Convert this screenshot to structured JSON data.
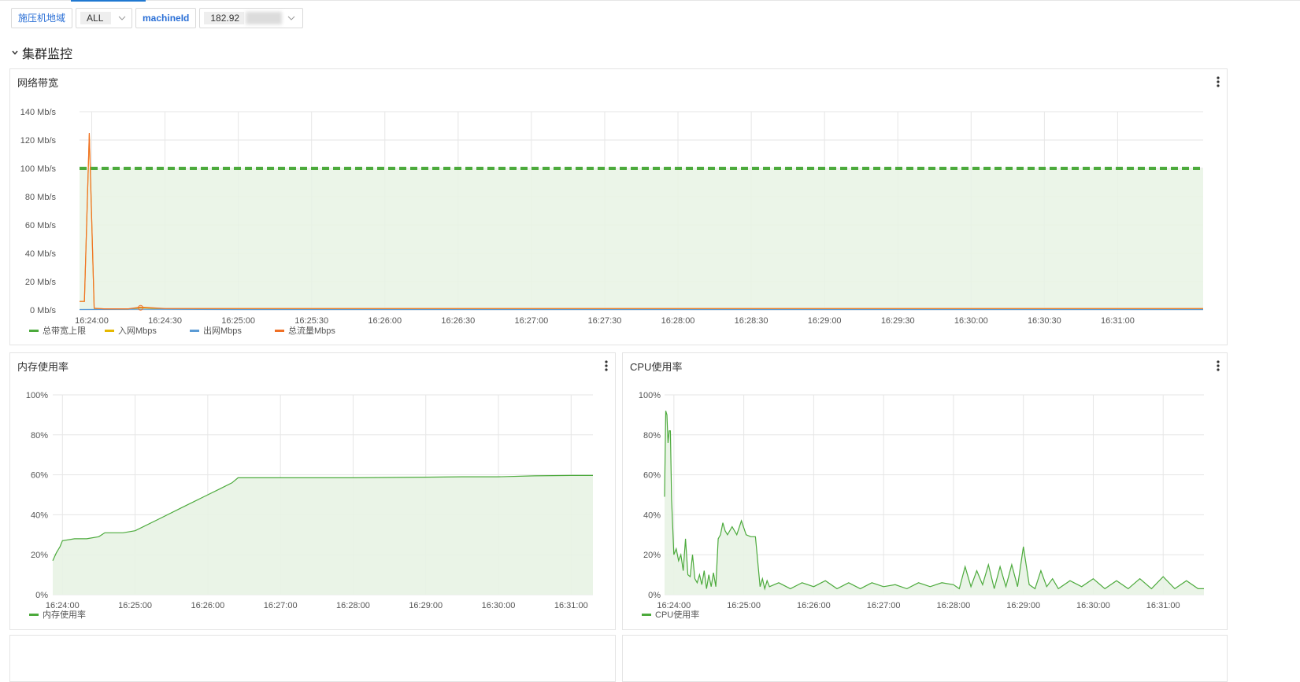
{
  "filters": {
    "region_label": "施压机地域",
    "region_value": "ALL",
    "machine_label": "machineId",
    "machine_value": "182.92"
  },
  "section": {
    "title": "集群监控"
  },
  "panels": {
    "bandwidth": {
      "title": "网络带宽"
    },
    "memory": {
      "title": "内存使用率"
    },
    "cpu": {
      "title": "CPU使用率"
    }
  },
  "colors": {
    "limit": "#4caa3c",
    "in": "#e6b800",
    "out": "#5b9bd5",
    "total": "#f07025",
    "series_green": "#4caa3c",
    "fill_green": "#e8f3e4"
  },
  "chart_data": [
    {
      "type": "line",
      "title": "网络带宽",
      "x_ticks": [
        "16:24:00",
        "16:24:30",
        "16:25:00",
        "16:25:30",
        "16:26:00",
        "16:26:30",
        "16:27:00",
        "16:27:30",
        "16:28:00",
        "16:28:30",
        "16:29:00",
        "16:29:30",
        "16:30:00",
        "16:30:30",
        "16:31:00"
      ],
      "y_ticks": [
        "0 Mb/s",
        "20 Mb/s",
        "40 Mb/s",
        "60 Mb/s",
        "80 Mb/s",
        "100 Mb/s",
        "120 Mb/s",
        "140 Mb/s"
      ],
      "ylim": [
        0,
        140
      ],
      "legend": "bottom-left",
      "grid": true,
      "series": [
        {
          "name": "总带宽上限",
          "style": "dashed-area",
          "x": [
            "16:23:55",
            "16:31:35"
          ],
          "values": [
            100,
            100
          ]
        },
        {
          "name": "入网Mbps",
          "x": [
            "16:23:55",
            "16:23:57",
            "16:23:59",
            "16:24:01",
            "16:24:05",
            "16:24:15",
            "16:24:20",
            "16:24:30",
            "16:25:00",
            "16:26:00",
            "16:27:00",
            "16:28:00",
            "16:29:00",
            "16:30:00",
            "16:31:00",
            "16:31:35"
          ],
          "values": [
            6,
            6,
            124,
            1,
            0.5,
            0.5,
            1.5,
            0.8,
            0.8,
            0.8,
            0.8,
            0.8,
            0.8,
            0.8,
            0.8,
            0.8
          ]
        },
        {
          "name": "出网Mbps",
          "x": [
            "16:23:55",
            "16:24:20",
            "16:25:00",
            "16:26:00",
            "16:27:00",
            "16:28:00",
            "16:29:00",
            "16:30:00",
            "16:31:00",
            "16:31:35"
          ],
          "values": [
            0.3,
            0.5,
            0.3,
            0.3,
            0.3,
            0.3,
            0.3,
            0.3,
            0.3,
            0.3
          ]
        },
        {
          "name": "总流量Mbps",
          "x": [
            "16:23:55",
            "16:23:57",
            "16:23:59",
            "16:24:01",
            "16:24:05",
            "16:24:15",
            "16:24:20",
            "16:24:30",
            "16:25:00",
            "16:26:00",
            "16:27:00",
            "16:28:00",
            "16:29:00",
            "16:30:00",
            "16:31:00",
            "16:31:35"
          ],
          "values": [
            6,
            6,
            125,
            1.2,
            0.8,
            0.8,
            2,
            1,
            1,
            1,
            1,
            1,
            1,
            1,
            1,
            1
          ]
        }
      ]
    },
    {
      "type": "area",
      "title": "内存使用率",
      "x_ticks": [
        "16:24:00",
        "16:25:00",
        "16:26:00",
        "16:27:00",
        "16:28:00",
        "16:29:00",
        "16:30:00",
        "16:31:00"
      ],
      "y_ticks": [
        "0%",
        "20%",
        "40%",
        "60%",
        "80%",
        "100%"
      ],
      "ylim": [
        0,
        100
      ],
      "legend": "bottom-left",
      "grid": true,
      "series": [
        {
          "name": "内存使用率",
          "x": [
            "16:23:52",
            "16:23:55",
            "16:23:58",
            "16:24:00",
            "16:24:10",
            "16:24:20",
            "16:24:30",
            "16:24:35",
            "16:24:50",
            "16:25:00",
            "16:25:20",
            "16:25:40",
            "16:26:00",
            "16:26:10",
            "16:26:20",
            "16:26:25",
            "16:27:00",
            "16:28:00",
            "16:29:00",
            "16:29:30",
            "16:30:00",
            "16:30:30",
            "16:31:00",
            "16:31:18"
          ],
          "values": [
            17,
            21,
            24,
            27,
            28,
            28,
            29,
            31,
            31,
            32,
            38,
            44,
            50,
            53,
            56,
            58.5,
            58.5,
            58.5,
            58.8,
            59,
            59,
            59.5,
            59.7,
            59.7
          ]
        }
      ]
    },
    {
      "type": "area",
      "title": "CPU使用率",
      "x_ticks": [
        "16:24:00",
        "16:25:00",
        "16:26:00",
        "16:27:00",
        "16:28:00",
        "16:29:00",
        "16:30:00",
        "16:31:00"
      ],
      "y_ticks": [
        "0%",
        "20%",
        "40%",
        "60%",
        "80%",
        "100%"
      ],
      "ylim": [
        0,
        100
      ],
      "legend": "bottom-left",
      "grid": true,
      "series": [
        {
          "name": "CPU使用率",
          "x": [
            "16:23:52",
            "16:23:53",
            "16:23:54",
            "16:23:55",
            "16:23:56",
            "16:23:57",
            "16:23:58",
            "16:24:00",
            "16:24:02",
            "16:24:04",
            "16:24:06",
            "16:24:08",
            "16:24:10",
            "16:24:12",
            "16:24:14",
            "16:24:16",
            "16:24:18",
            "16:24:20",
            "16:24:22",
            "16:24:24",
            "16:24:26",
            "16:24:28",
            "16:24:30",
            "16:24:32",
            "16:24:34",
            "16:24:36",
            "16:24:38",
            "16:24:40",
            "16:24:42",
            "16:24:44",
            "16:24:46",
            "16:24:50",
            "16:24:54",
            "16:24:58",
            "16:25:02",
            "16:25:06",
            "16:25:10",
            "16:25:14",
            "16:25:16",
            "16:25:18",
            "16:25:20",
            "16:25:22",
            "16:25:30",
            "16:25:40",
            "16:25:50",
            "16:26:00",
            "16:26:10",
            "16:26:20",
            "16:26:30",
            "16:26:40",
            "16:26:50",
            "16:27:00",
            "16:27:10",
            "16:27:20",
            "16:27:30",
            "16:27:40",
            "16:27:50",
            "16:28:00",
            "16:28:05",
            "16:28:10",
            "16:28:15",
            "16:28:20",
            "16:28:25",
            "16:28:30",
            "16:28:35",
            "16:28:40",
            "16:28:45",
            "16:28:50",
            "16:28:55",
            "16:29:00",
            "16:29:05",
            "16:29:10",
            "16:29:15",
            "16:29:20",
            "16:29:25",
            "16:29:30",
            "16:29:40",
            "16:29:50",
            "16:30:00",
            "16:30:10",
            "16:30:20",
            "16:30:30",
            "16:30:40",
            "16:30:50",
            "16:31:00",
            "16:31:10",
            "16:31:20",
            "16:31:30",
            "16:31:35"
          ],
          "values": [
            49,
            92,
            90,
            76,
            82,
            82,
            48,
            20,
            23,
            17,
            20,
            12,
            28,
            10,
            9,
            20,
            8,
            6,
            10,
            5,
            12,
            3,
            10,
            4,
            11,
            4,
            28,
            30,
            36,
            32,
            30,
            34,
            30,
            37,
            30,
            29,
            29,
            4,
            8,
            3,
            7,
            4,
            6,
            3,
            6,
            4,
            7,
            3,
            6,
            3,
            6,
            4,
            5,
            3,
            6,
            4,
            6,
            5,
            3,
            14,
            4,
            12,
            5,
            15,
            3,
            14,
            4,
            15,
            4,
            24,
            5,
            3,
            12,
            4,
            8,
            3,
            7,
            4,
            8,
            3,
            7,
            3,
            8,
            3,
            9,
            3,
            7,
            3,
            3
          ]
        }
      ]
    }
  ]
}
